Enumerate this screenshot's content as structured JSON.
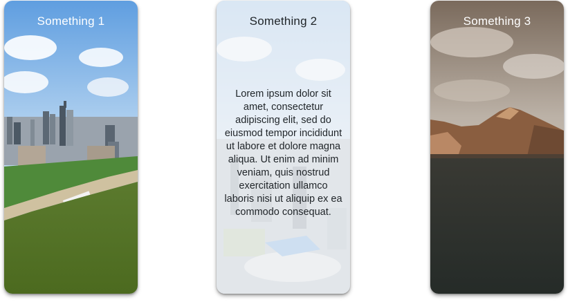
{
  "cards": [
    {
      "title": "Something 1",
      "image": "city-riverside-aerial"
    },
    {
      "title": "Something 2",
      "image": "city-aerial-frosted",
      "body": "Lorem ipsum dolor sit amet, consectetur adipiscing elit, sed do eiusmod tempor incididunt ut labore et dolore magna aliqua. Ut enim ad minim veniam, quis nostrud exercitation ullamco laboris nisi ut aliquip ex ea commodo consequat."
    },
    {
      "title": "Something 3",
      "image": "mountain-lake-cloudy"
    }
  ]
}
